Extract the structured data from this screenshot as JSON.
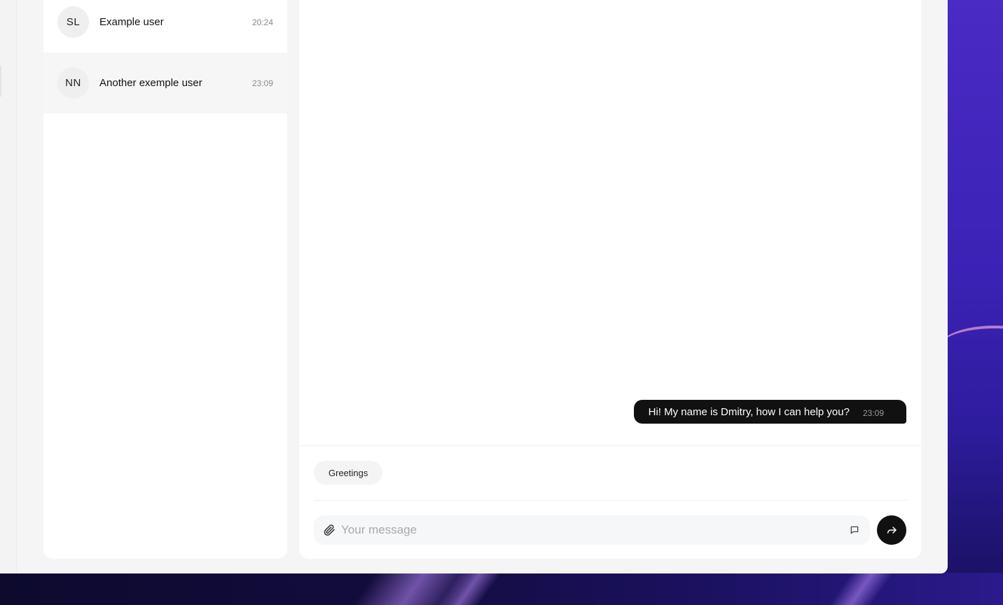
{
  "contacts": [
    {
      "initials": "SL",
      "name": "Example user",
      "time": "20:24"
    },
    {
      "initials": "NN",
      "name": "Another exemple user",
      "time": "23:09"
    }
  ],
  "chat": {
    "messages": [
      {
        "text": "Hi! My name is Dmitry, how I can help you?",
        "time": "23:09"
      }
    ],
    "quick_replies": [
      "Greetings"
    ],
    "composer": {
      "placeholder": "Your message"
    }
  },
  "icons": {
    "attach": "paperclip-icon",
    "emoji": "message-square-icon",
    "send": "forward-arrow-icon"
  },
  "colors": {
    "accent": "#111111",
    "window_bg": "#f5f5f5",
    "panel_bg": "#ffffff",
    "wallpaper": "#3b22b5"
  }
}
